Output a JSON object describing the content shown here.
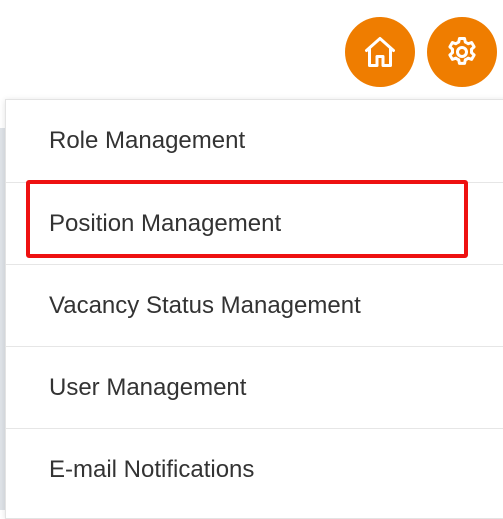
{
  "header": {
    "home_icon": "home-icon",
    "settings_icon": "gear-icon"
  },
  "menu": {
    "items": [
      {
        "label": "Role Management"
      },
      {
        "label": "Position Management"
      },
      {
        "label": "Vacancy Status Management"
      },
      {
        "label": "User Management"
      },
      {
        "label": "E-mail Notifications"
      }
    ],
    "highlighted_item": "Position Management"
  },
  "colors": {
    "accent": "#ef7d00",
    "highlight": "#ee1111",
    "text": "#333333",
    "divider": "#e6e6e6"
  }
}
